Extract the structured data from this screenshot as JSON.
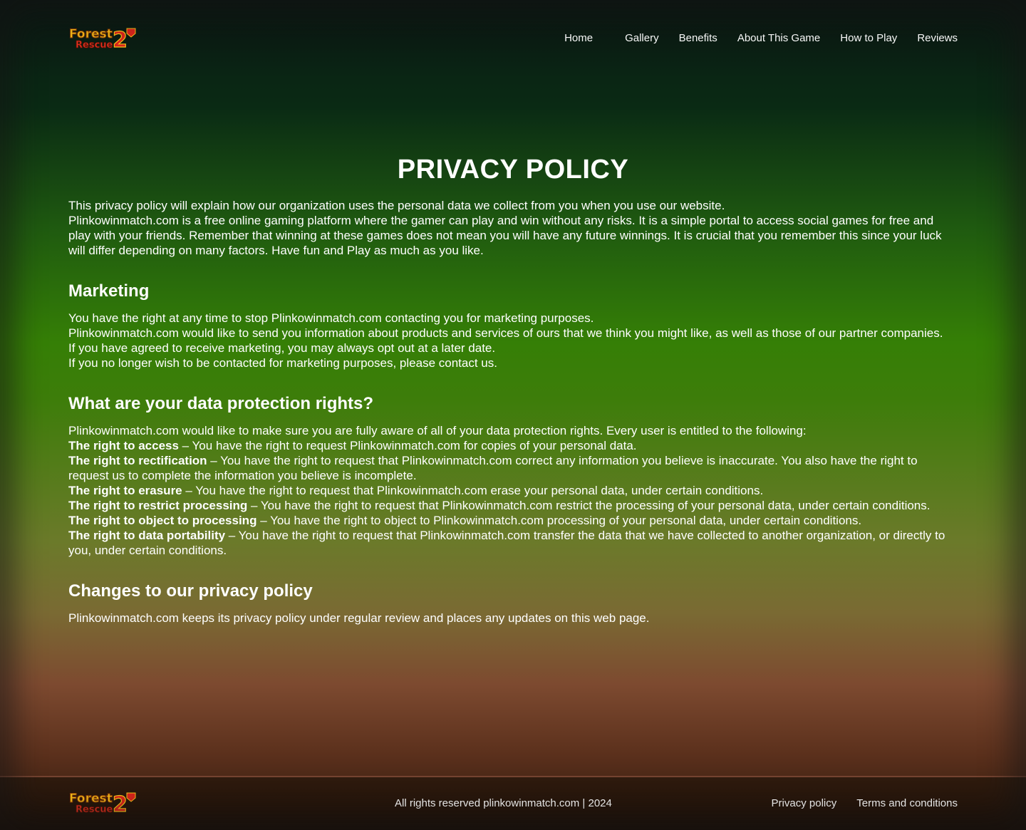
{
  "brand": {
    "logo_word1": "Forest",
    "logo_word2": "Rescue",
    "logo_number": "2"
  },
  "nav": {
    "items": [
      {
        "label": "Home"
      },
      {
        "label": "Gallery"
      },
      {
        "label": "Benefits"
      },
      {
        "label": "About This Game"
      },
      {
        "label": "How to Play"
      },
      {
        "label": "Reviews"
      }
    ]
  },
  "main": {
    "title": "PRIVACY POLICY",
    "intro": [
      "This privacy policy will explain how our organization uses the personal data we collect from you when you use our website.",
      "Plinkowinmatch.com is a free online gaming platform where the gamer can play and win without any risks. It is a simple portal to access social games for free and play with your friends. Remember that winning at these games does not mean you will have any future winnings. It is crucial that you remember this since your luck will differ depending on many factors. Have fun and Play as much as you like."
    ],
    "marketing": {
      "heading": "Marketing",
      "lines": [
        "You have the right at any time to stop Plinkowinmatch.com contacting you for marketing purposes.",
        "Plinkowinmatch.com would like to send you information about products and services of ours that we think you might like, as well as those of our partner companies.",
        "If you have agreed to receive marketing, you may always opt out at a later date.",
        "If you no longer wish to be contacted for marketing purposes, please contact us."
      ]
    },
    "rights": {
      "heading": "What are your data protection rights?",
      "intro": "Plinkowinmatch.com would like to make sure you are fully aware of all of your data protection rights. Every user is entitled to the following:",
      "items": [
        {
          "term": "The right to access",
          "text": " – You have the right to request Plinkowinmatch.com for copies of your personal data."
        },
        {
          "term": "The right to rectification",
          "text": " – You have the right to request that Plinkowinmatch.com correct any information you believe is inaccurate. You also have the right to request us to complete the information you believe is incomplete."
        },
        {
          "term": "The right to erasure",
          "text": " – You have the right to request that Plinkowinmatch.com erase your personal data, under certain conditions."
        },
        {
          "term": "The right to restrict processing",
          "text": " – You have the right to request that Plinkowinmatch.com restrict the processing of your personal data, under certain conditions."
        },
        {
          "term": "The right to object to processing",
          "text": " – You have the right to object to Plinkowinmatch.com processing of your personal data, under certain conditions."
        },
        {
          "term": "The right to data portability",
          "text": " – You have the right to request that Plinkowinmatch.com transfer the data that we have collected to another organization, or directly to you, under certain conditions."
        }
      ]
    },
    "changes": {
      "heading": "Changes to our privacy policy",
      "text": "Plinkowinmatch.com keeps its privacy policy under regular review and places any updates on this web page."
    }
  },
  "footer": {
    "copyright": "All rights reserved plinkowinmatch.com | 2024",
    "links": [
      {
        "label": "Privacy policy"
      },
      {
        "label": "Terms and conditions"
      }
    ]
  },
  "colors": {
    "logo_yellow": "#f7c21a",
    "logo_red": "#d8251c",
    "text": "#ffffff"
  }
}
